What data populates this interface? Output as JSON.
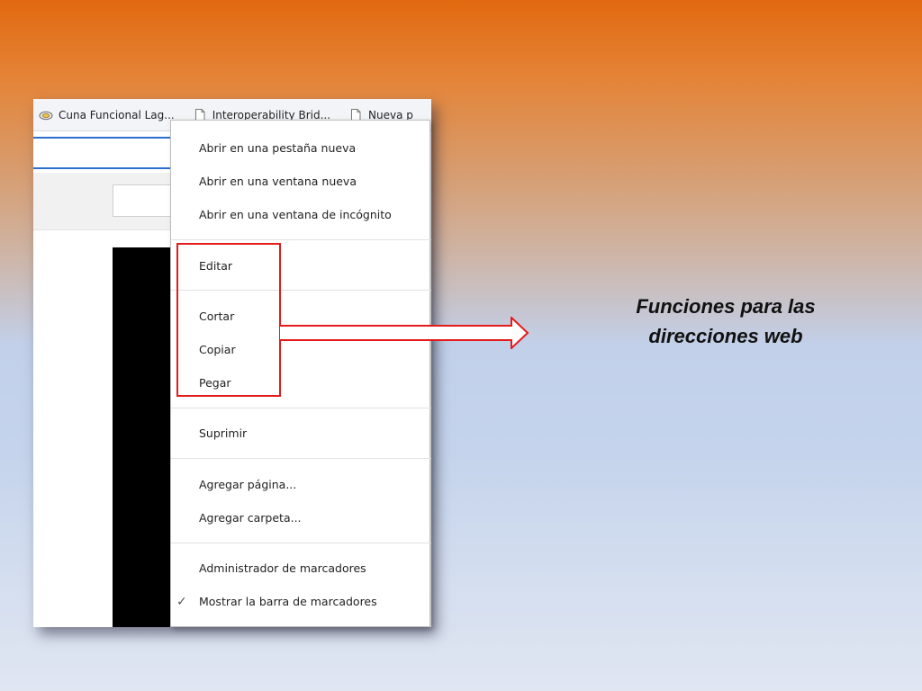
{
  "bookmarks_bar": {
    "items": [
      {
        "label": "Cuna Funcional Lag...",
        "icon": "cloud-favicon-icon"
      },
      {
        "label": "Interoperability Brid...",
        "icon": "page-icon"
      },
      {
        "label": "Nueva p",
        "icon": "page-icon"
      }
    ]
  },
  "context_menu": {
    "items": [
      {
        "label": "Abrir en una pestaña nueva"
      },
      {
        "label": "Abrir en una ventana nueva"
      },
      {
        "label": "Abrir en una ventana de incógnito"
      },
      {
        "label": "Editar"
      },
      {
        "label": "Cortar"
      },
      {
        "label": "Copiar"
      },
      {
        "label": "Pegar"
      },
      {
        "label": "Suprimir"
      },
      {
        "label": "Agregar página..."
      },
      {
        "label": "Agregar carpeta..."
      },
      {
        "label": "Administrador de marcadores"
      },
      {
        "label": "Mostrar la barra de marcadores",
        "checked": true
      }
    ]
  },
  "annotation": {
    "caption_line1": "Funciones para las",
    "caption_line2": "direcciones web",
    "highlight_color": "#e31b1b"
  }
}
